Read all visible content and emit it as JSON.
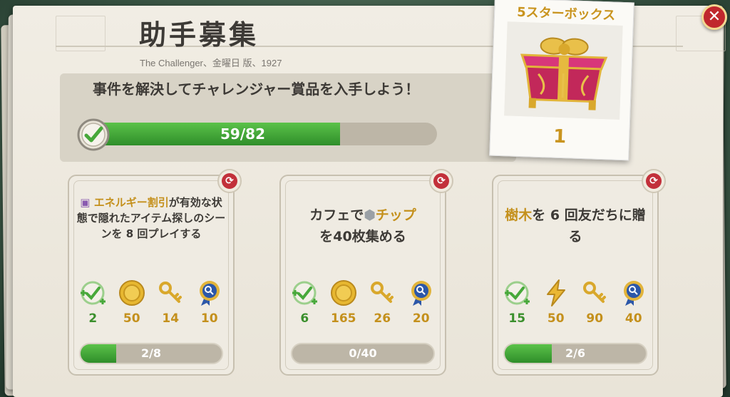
{
  "header": {
    "title": "助手募集",
    "subtitle": "The Challenger、金曜日 版、1927"
  },
  "banner": {
    "text": "事件を解決してチャレンジャー賞品を入手しよう！",
    "progress_label": "59/82",
    "progress_value": 59,
    "progress_max": 82
  },
  "reward_box": {
    "title": "5スターボックス",
    "count": "1"
  },
  "close_label": "✕",
  "quests": [
    {
      "text_parts": [
        "エネルギー割引",
        "が有効な状態で隠れたアイテム探しのシーンを 8 回プレイする"
      ],
      "rewards": [
        "2",
        "50",
        "14",
        "10"
      ],
      "progress_label": "2/8",
      "progress_value": 2,
      "progress_max": 8
    },
    {
      "text_parts": [
        "カフェで",
        "チップ",
        "を40枚集める"
      ],
      "rewards": [
        "6",
        "165",
        "26",
        "20"
      ],
      "progress_label": "0/40",
      "progress_value": 0,
      "progress_max": 40
    },
    {
      "text_parts": [
        "樹木",
        "を 6 回友だちに贈る"
      ],
      "rewards": [
        "15",
        "50",
        "90",
        "40"
      ],
      "progress_label": "2/6",
      "progress_value": 2,
      "progress_max": 6
    }
  ],
  "colors": {
    "accent_gold": "#c4901c",
    "progress_green": "#3a9a30",
    "close_red": "#c0272d"
  }
}
